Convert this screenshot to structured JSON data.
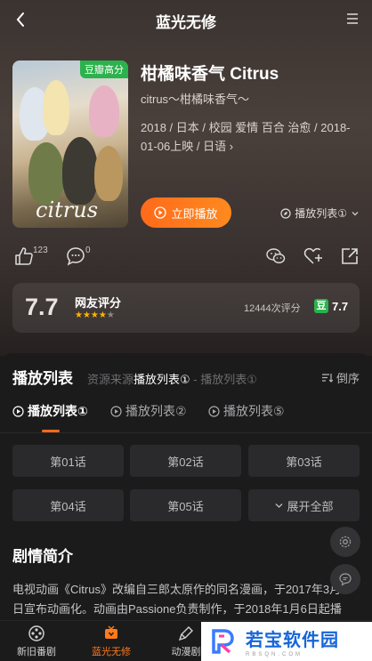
{
  "header": {
    "title": "蓝光无修"
  },
  "movie": {
    "poster_badge": "豆瓣高分",
    "poster_logo": "citrus",
    "title": "柑橘味香气 Citrus",
    "subtitle": "citrus～柑橘味香气～",
    "meta_line": "2018 / 日本 / 校园 爱情 百合 治愈 / 2018-01-06上映 / 日语 ›",
    "play_label": "立即播放",
    "playlist_select": "播放列表①"
  },
  "actions": {
    "like_count": "123",
    "comment_count": "0"
  },
  "rating": {
    "score": "7.7",
    "label": "网友评分",
    "stars_on": "★★★★",
    "stars_off": "★",
    "count_text": "12444次评分",
    "douban_icon": "豆",
    "douban_score": "7.7"
  },
  "playlist_section": {
    "title": "播放列表",
    "source_tabs": [
      "资源来源",
      "播放列表①",
      " - 播放列表①"
    ],
    "sort_label": "倒序",
    "tabs": [
      "播放列表①",
      "播放列表②",
      "播放列表⑤"
    ],
    "episodes": [
      "第01话",
      "第02话",
      "第03话",
      "第04话",
      "第05话",
      "展开全部"
    ]
  },
  "synopsis": {
    "title": "剧情简介",
    "text": "电视动画《Citrus》改编自三郎太原作的同名漫画，于2017年3月日宣布动画化。动画由Passione负责制作，于2018年1月6日起播"
  },
  "bottom_nav": [
    "新旧番剧",
    "蓝光无修",
    "动漫剧"
  ],
  "watermark": {
    "main": "若宝软件园",
    "sub": "RBSQN.COM"
  },
  "colors": {
    "accent": "#ff6a1a",
    "douban_green": "#2bb24c",
    "star": "#ffb400"
  }
}
